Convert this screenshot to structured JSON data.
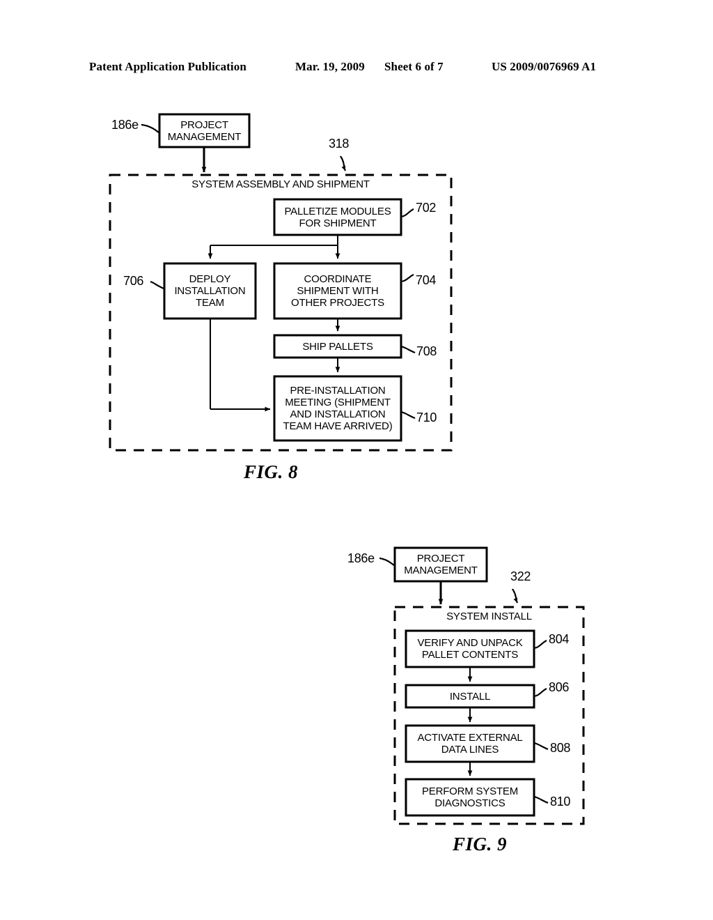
{
  "header": {
    "publication": "Patent Application Publication",
    "date": "Mar. 19, 2009",
    "sheet": "Sheet 6 of 7",
    "patent_number": "US 2009/0076969 A1"
  },
  "figures": [
    {
      "caption": "FIG. 8",
      "source_node": {
        "label": "PROJECT\nMANAGEMENT",
        "ref": "186e"
      },
      "group": {
        "title": "SYSTEM ASSEMBLY AND SHIPMENT",
        "ref": "318"
      },
      "nodes": [
        {
          "label": "PALLETIZE MODULES\nFOR SHIPMENT",
          "ref": "702"
        },
        {
          "label": "DEPLOY\nINSTALLATION\nTEAM",
          "ref": "706"
        },
        {
          "label": "COORDINATE\nSHIPMENT WITH\nOTHER PROJECTS",
          "ref": "704"
        },
        {
          "label": "SHIP PALLETS",
          "ref": "708"
        },
        {
          "label": "PRE-INSTALLATION\nMEETING (SHIPMENT\nAND INSTALLATION\nTEAM HAVE ARRIVED)",
          "ref": "710"
        }
      ]
    },
    {
      "caption": "FIG. 9",
      "source_node": {
        "label": "PROJECT\nMANAGEMENT",
        "ref": "186e"
      },
      "group": {
        "title": "SYSTEM INSTALL",
        "ref": "322"
      },
      "nodes": [
        {
          "label": "VERIFY AND UNPACK\nPALLET CONTENTS",
          "ref": "804"
        },
        {
          "label": "INSTALL",
          "ref": "806"
        },
        {
          "label": "ACTIVATE EXTERNAL\nDATA LINES",
          "ref": "808"
        },
        {
          "label": "PERFORM SYSTEM\nDIAGNOSTICS",
          "ref": "810"
        }
      ]
    }
  ],
  "chart_data": {
    "type": "diagram",
    "title": "Patent flowchart sheet 6 of 7",
    "diagrams": [
      {
        "name": "FIG. 8",
        "container": "SYSTEM ASSEMBLY AND SHIPMENT",
        "container_ref": "318",
        "edges": [
          {
            "from": "PROJECT MANAGEMENT (186e)",
            "to": "SYSTEM ASSEMBLY AND SHIPMENT (318)"
          },
          {
            "from": "PALLETIZE MODULES FOR SHIPMENT (702)",
            "to": "DEPLOY INSTALLATION TEAM (706)"
          },
          {
            "from": "PALLETIZE MODULES FOR SHIPMENT (702)",
            "to": "COORDINATE SHIPMENT WITH OTHER PROJECTS (704)"
          },
          {
            "from": "COORDINATE SHIPMENT WITH OTHER PROJECTS (704)",
            "to": "SHIP PALLETS (708)"
          },
          {
            "from": "SHIP PALLETS (708)",
            "to": "PRE-INSTALLATION MEETING (710)"
          },
          {
            "from": "DEPLOY INSTALLATION TEAM (706)",
            "to": "PRE-INSTALLATION MEETING (710)"
          }
        ]
      },
      {
        "name": "FIG. 9",
        "container": "SYSTEM INSTALL",
        "container_ref": "322",
        "edges": [
          {
            "from": "PROJECT MANAGEMENT (186e)",
            "to": "SYSTEM INSTALL (322)"
          },
          {
            "from": "VERIFY AND UNPACK PALLET CONTENTS (804)",
            "to": "INSTALL (806)"
          },
          {
            "from": "INSTALL (806)",
            "to": "ACTIVATE EXTERNAL DATA LINES (808)"
          },
          {
            "from": "ACTIVATE EXTERNAL DATA LINES (808)",
            "to": "PERFORM SYSTEM DIAGNOSTICS (810)"
          }
        ]
      }
    ]
  },
  "colors": {
    "ink": "#000000",
    "paper": "#ffffff"
  }
}
